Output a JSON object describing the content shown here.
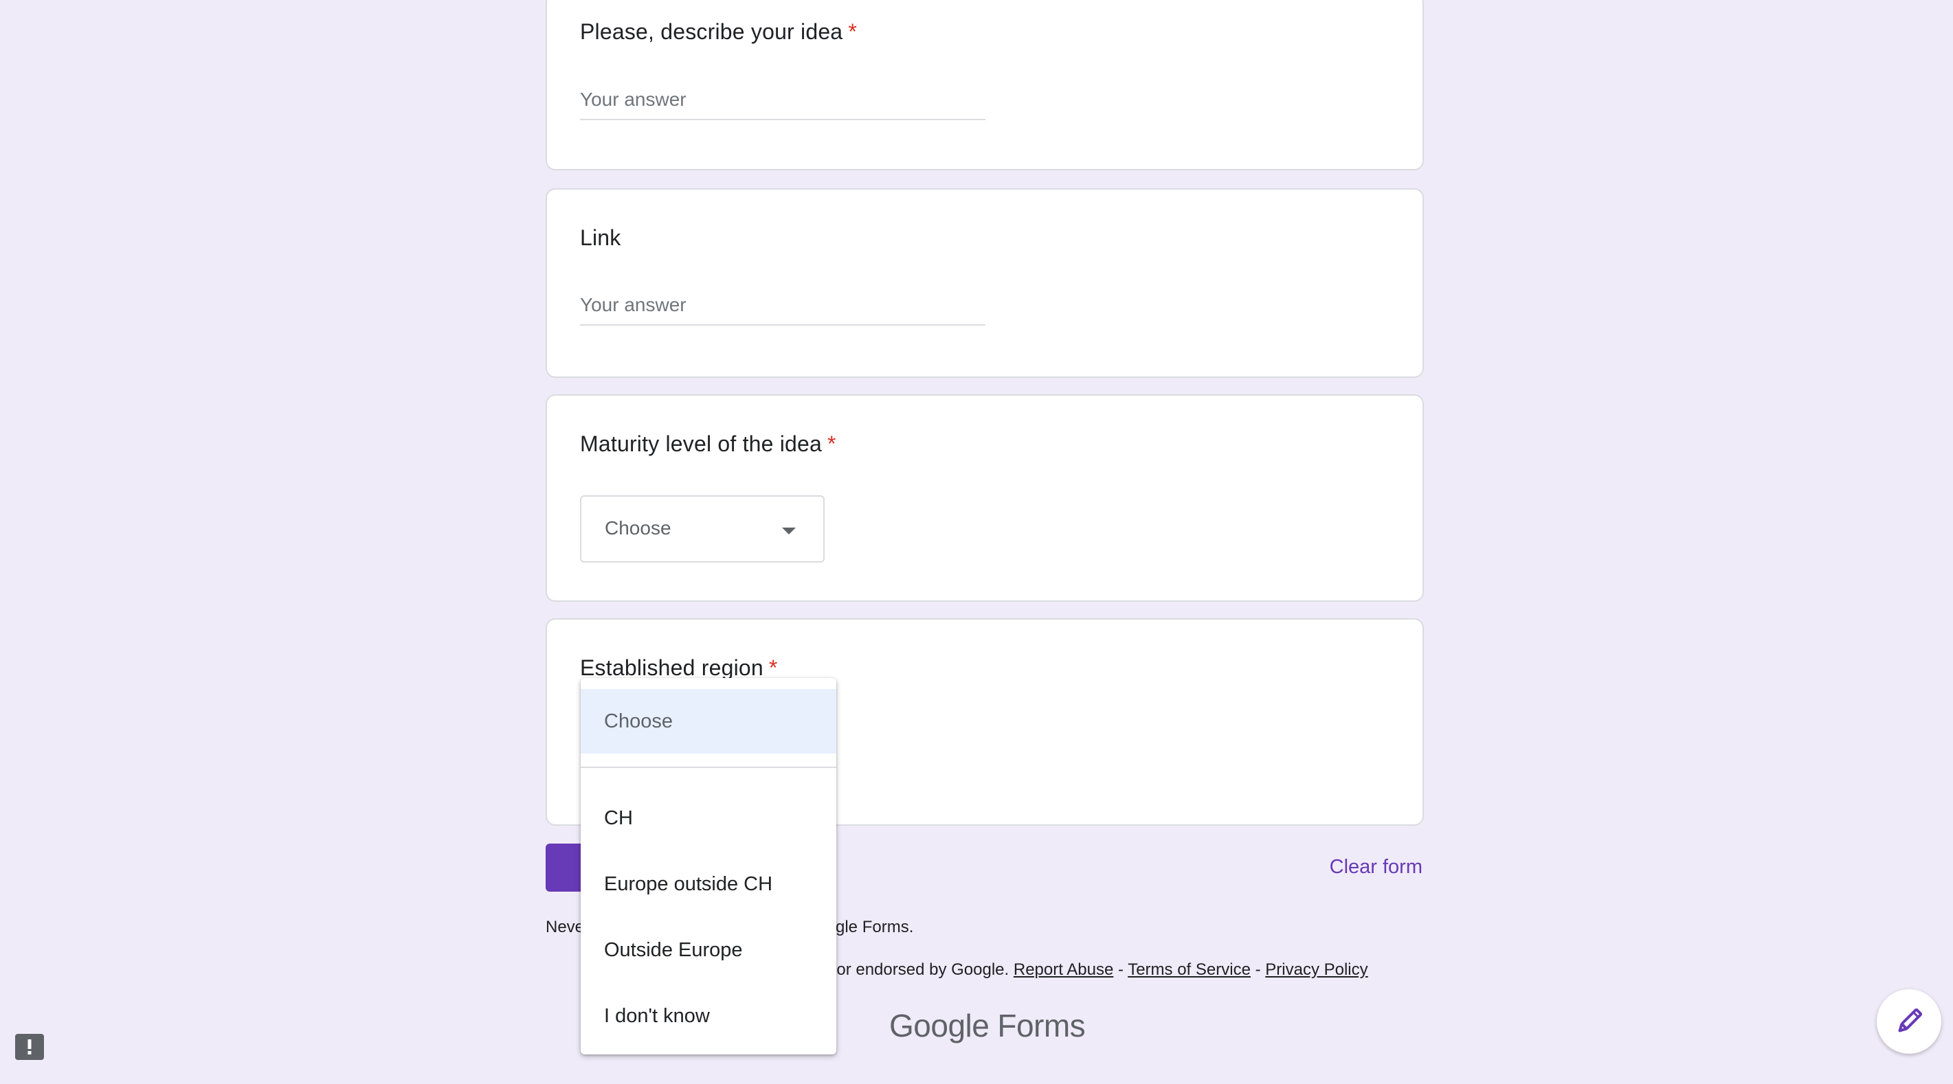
{
  "questions": {
    "idea": {
      "title": "Please, describe your idea",
      "required_mark": "*",
      "placeholder": "Your answer"
    },
    "link": {
      "title": "Link",
      "placeholder": "Your answer"
    },
    "maturity": {
      "title": "Maturity level of the idea",
      "required_mark": "*",
      "selected": "Choose"
    },
    "region": {
      "title": "Established region",
      "required_mark": "*"
    }
  },
  "dropdown": {
    "selected": "Choose",
    "options": [
      "CH",
      "Europe outside CH",
      "Outside Europe",
      "I don't know"
    ]
  },
  "actions": {
    "clear_form": "Clear form"
  },
  "footer": {
    "never_prefix": "Neve",
    "never_suffix": "gle Forms.",
    "endorse_text": "nor endorsed by Google.",
    "report_abuse": "Report Abuse",
    "sep": "-",
    "terms": "Terms of Service",
    "privacy": "Privacy Policy",
    "logo_google": "Google",
    "logo_forms": "Forms"
  },
  "icons": {
    "dropdown_arrow": "arrow-drop-down-icon",
    "edit": "pencil-icon",
    "feedback": "report-issue-icon"
  },
  "colors": {
    "accent": "#673ab7",
    "background": "#f0ebf8",
    "required": "#d93025",
    "highlight": "#e8f0fe"
  }
}
